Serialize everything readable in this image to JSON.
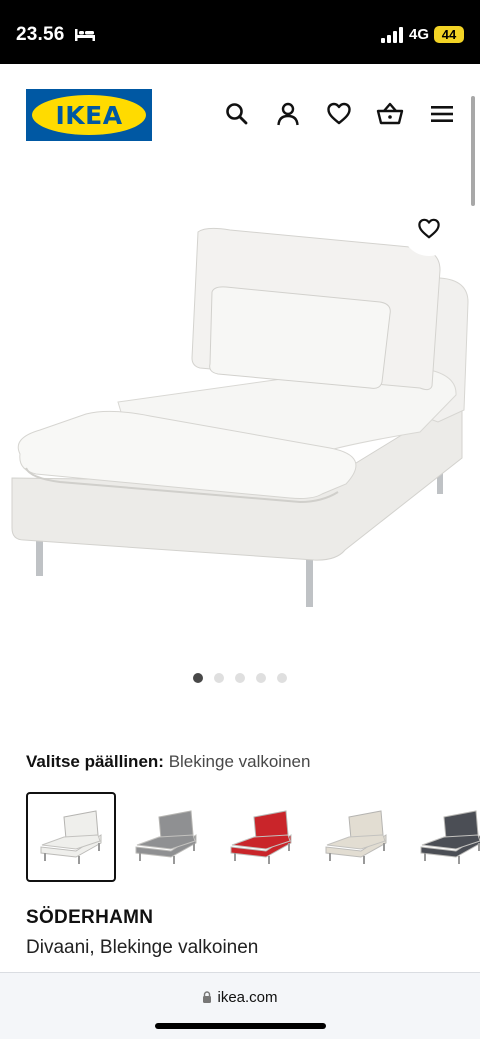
{
  "status_bar": {
    "time": "23.56",
    "network": "4G",
    "battery": "44",
    "icons": [
      "bed-icon",
      "signal-icon"
    ]
  },
  "header": {
    "logo_text": "IKEA",
    "icons": [
      "search-icon",
      "account-icon",
      "favourites-icon",
      "basket-icon",
      "menu-icon"
    ]
  },
  "product_image": {
    "favourite_icon": "heart-icon",
    "pagination_total": 5,
    "pagination_active": 1
  },
  "cover": {
    "label": "Valitse päällinen:",
    "value": "Blekinge valkoinen",
    "options": [
      {
        "color": "#efefec",
        "selected": true
      },
      {
        "color": "#8f9092",
        "selected": false
      },
      {
        "color": "#c9252a",
        "selected": false
      },
      {
        "color": "#e2ddd2",
        "selected": false
      },
      {
        "color": "#4b4e55",
        "selected": false
      }
    ]
  },
  "product": {
    "name": "SÖDERHAMN",
    "description": "Divaani, Blekinge valkoinen"
  },
  "browser": {
    "url": "ikea.com"
  },
  "colors": {
    "ikea_blue": "#0058a3",
    "ikea_yellow": "#ffdb00",
    "battery_yellow": "#f2d325"
  }
}
